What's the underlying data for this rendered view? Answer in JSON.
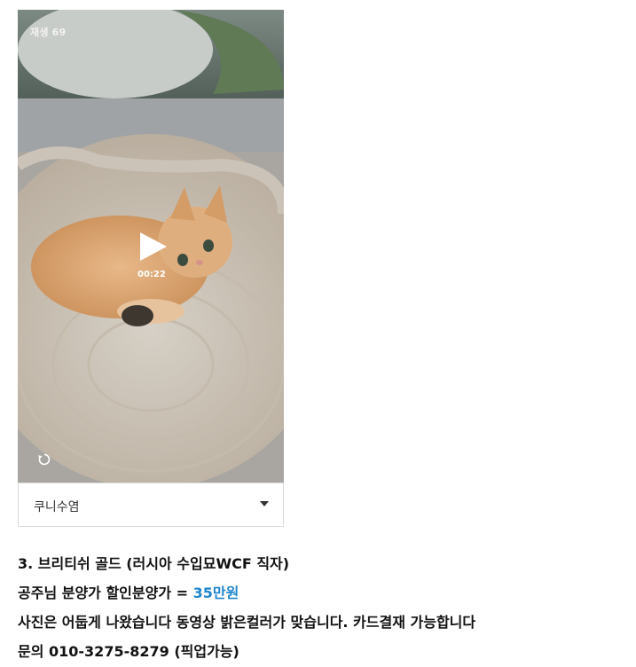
{
  "video": {
    "play_count": "재생 69",
    "duration": "00:22",
    "icons": {
      "play": "play-icon",
      "replay": "replay-icon"
    }
  },
  "option_select": {
    "selected": "쿠니수염",
    "icon": "chevron-down-icon"
  },
  "description": {
    "line1": "3. 브리티쉬 골드  (러시아 수입묘WCF 직자)",
    "line2_prefix": "공주님 분양가   할인분양가 = ",
    "line2_price": "35만원",
    "line3": "사진은 어둡게 나왔습니다 동영상 밝은컬러가 맞습니다.    카드결재 가능합니다",
    "line4": "문의 010-3275-8279 (픽업가능)"
  },
  "colors": {
    "price": "#1f86cc",
    "text": "#111111"
  }
}
